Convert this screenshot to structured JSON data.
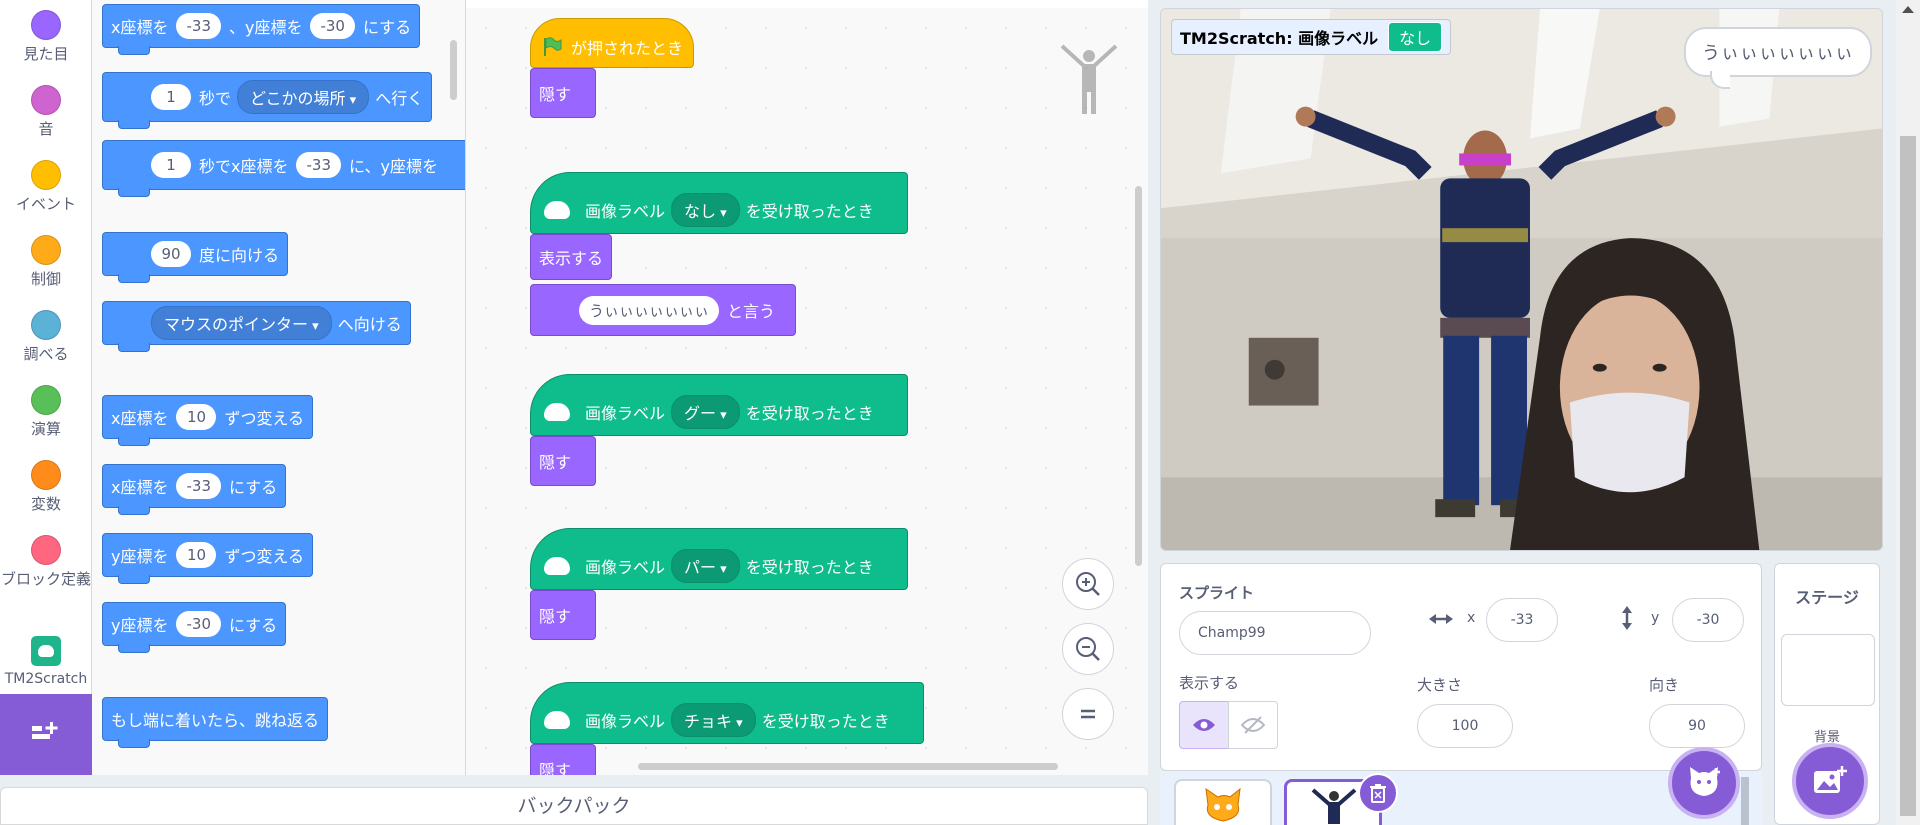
{
  "categories": [
    {
      "label": "見た目",
      "color": "#9966ff",
      "icon": "looks-dot"
    },
    {
      "label": "音",
      "color": "#cf63cf",
      "icon": "sound-dot"
    },
    {
      "label": "イベント",
      "color": "#ffbf00",
      "icon": "events-dot"
    },
    {
      "label": "制御",
      "color": "#ffab19",
      "icon": "control-dot"
    },
    {
      "label": "調べる",
      "color": "#5cb1d6",
      "icon": "sensing-dot"
    },
    {
      "label": "演算",
      "color": "#59c059",
      "icon": "operators-dot"
    },
    {
      "label": "変数",
      "color": "#ff8c1a",
      "icon": "variables-dot"
    },
    {
      "label": "ブロック定義",
      "color": "#ff6680",
      "icon": "myblocks-dot"
    },
    {
      "label": "TM2Scratch",
      "color": "#1fb48a",
      "icon": "tm2scratch-icon"
    }
  ],
  "flyout": {
    "b1": {
      "a": "x座標を",
      "v1": "-33",
      "b": "、y座標を",
      "v2": "-30",
      "c": "にする"
    },
    "b2": {
      "v1": "1",
      "a": "秒で",
      "dd": "どこかの場所",
      "b": "へ行く"
    },
    "b3": {
      "v1": "1",
      "a": "秒でx座標を",
      "v2": "-33",
      "b": "に、y座標を"
    },
    "b4": {
      "v1": "90",
      "a": "度に向ける"
    },
    "b5": {
      "dd": "マウスのポインター",
      "a": "へ向ける"
    },
    "b6": {
      "a": "x座標を",
      "v1": "10",
      "b": "ずつ変える"
    },
    "b7": {
      "a": "x座標を",
      "v1": "-33",
      "b": "にする"
    },
    "b8": {
      "a": "y座標を",
      "v1": "10",
      "b": "ずつ変える"
    },
    "b9": {
      "a": "y座標を",
      "v1": "-30",
      "b": "にする"
    },
    "b10": {
      "a": "もし端に着いたら、跳ね返る"
    }
  },
  "scripts": {
    "flag_hat": "が押されたとき",
    "hide": "隠す",
    "show": "表示する",
    "say_value": "うぃぃぃぃぃぃぃ",
    "say": "と言う",
    "label_prefix": "画像ラベル",
    "label_suffix": "を受け取ったとき",
    "labels": [
      "なし",
      "グー",
      "パー",
      "チョキ"
    ],
    "hide_cut": "隠す"
  },
  "backpack": "バックパック",
  "stage": {
    "monitor_label": "TM2Scratch: 画像ラベル",
    "monitor_value": "なし",
    "speech": "うぃぃぃぃぃぃぃ"
  },
  "sprite_info": {
    "sprite_label": "スプライト",
    "sprite_name": "Champ99",
    "x_label": "x",
    "x": "-33",
    "y_label": "y",
    "y": "-30",
    "show_label": "表示する",
    "size_label": "大きさ",
    "size": "100",
    "direction_label": "向き",
    "direction": "90"
  },
  "stage_panel": {
    "title": "ステージ",
    "backdrop": "背景"
  },
  "colors": {
    "motion": "#4c97ff",
    "looks": "#9966ff",
    "events": "#ffbf00",
    "extension": "#0fbd8c",
    "accent": "#855cd6"
  }
}
